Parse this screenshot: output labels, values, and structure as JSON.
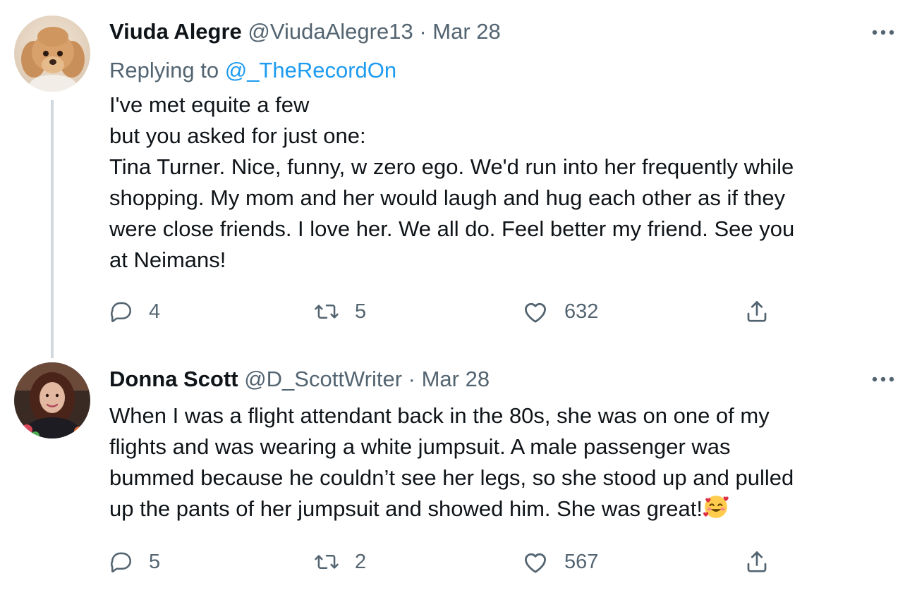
{
  "tweets": [
    {
      "author_name": "Viuda Alegre",
      "handle": "@ViudaAlegre13",
      "separator": "·",
      "date": "Mar 28",
      "replying_prefix": "Replying to ",
      "replying_handle": "@_TheRecordOn",
      "avatar": "poodle-dog-avatar",
      "lines": [
        "I've met equite a few",
        "but you asked for just one:",
        "Tina Turner. Nice, funny, w zero ego. We'd run into her frequently while",
        "shopping. My mom and her would laugh and hug each other as if they",
        "were close friends.  I love her. We all do. Feel better my friend. See you",
        "at Neimans!"
      ],
      "replies": "4",
      "retweets": "5",
      "likes": "632"
    },
    {
      "author_name": "Donna Scott",
      "handle": "@D_ScottWriter",
      "separator": "·",
      "date": "Mar 28",
      "avatar": "woman-portrait-avatar",
      "lines": [
        "When I was a flight attendant back in the 80s, she was on one of my",
        "flights and was wearing a white jumpsuit. A male passenger was",
        "bummed because he couldn’t see her legs, so she stood up and pulled",
        "up the pants of her jumpsuit and showed him. She was great!"
      ],
      "trailing_emoji": "smiling-face-with-hearts",
      "replies": "5",
      "retweets": "2",
      "likes": "567"
    }
  ],
  "icons": {
    "reply": "speech-bubble-icon",
    "retweet": "retweet-arrows-icon",
    "like": "heart-outline-icon",
    "share": "share-upload-icon",
    "more": "more-dots-icon"
  },
  "colors": {
    "text": "#0f1419",
    "secondary": "#536471",
    "link": "#1d9bf0",
    "thread_line": "#cfd9de"
  }
}
